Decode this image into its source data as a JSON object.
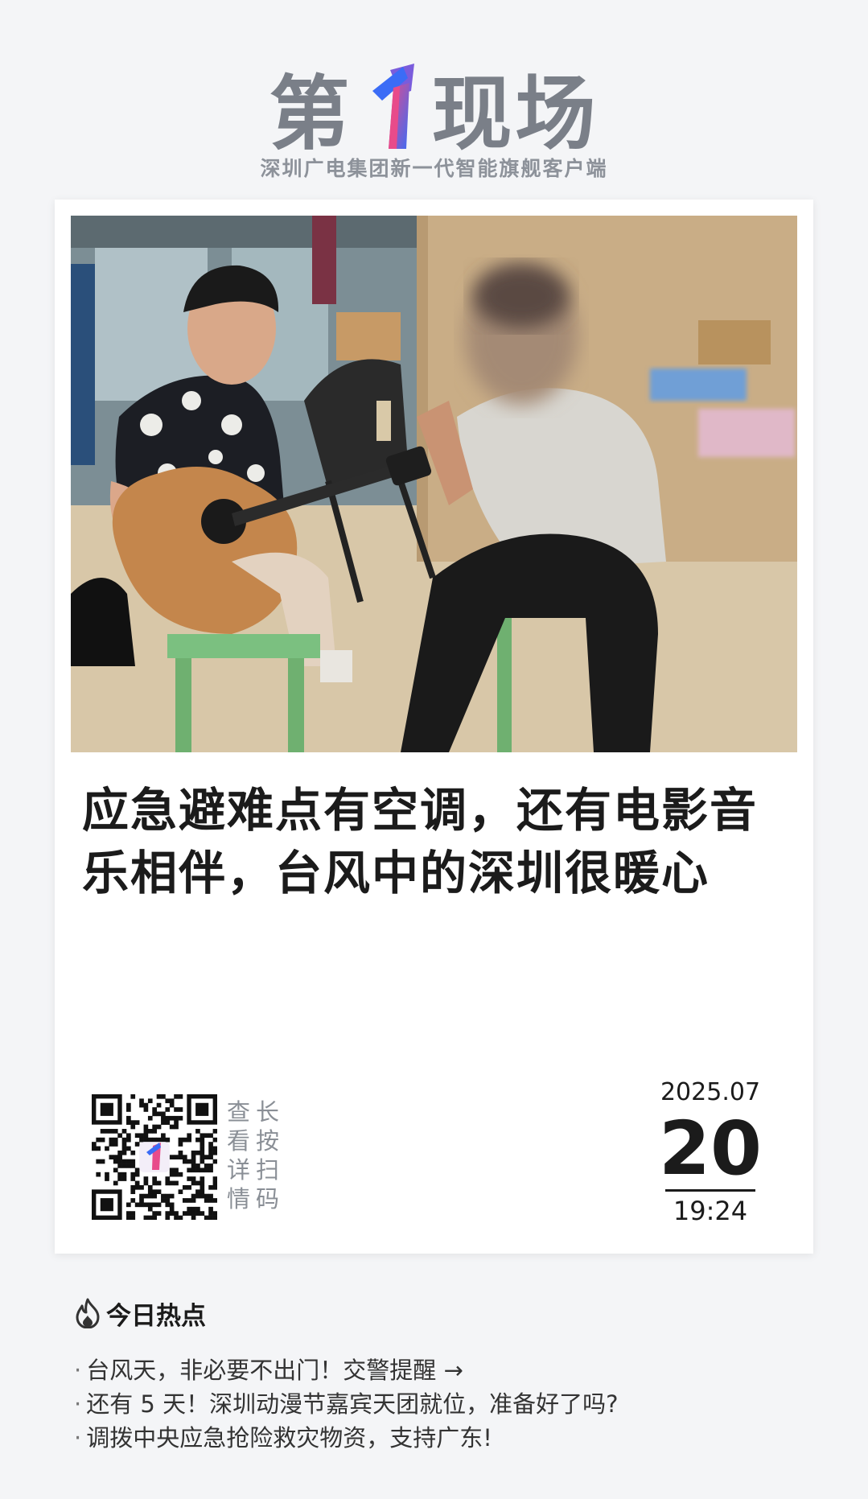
{
  "header": {
    "logo_left": "第",
    "logo_right": "现场",
    "tagline": "深圳广电集团新一代智能旗舰客户端",
    "brand_colors": [
      "#3b6cf6",
      "#e84b8a",
      "#7a7f88"
    ]
  },
  "article": {
    "headline": "应急避难点有空调，还有电影音乐相伴，台风中的深圳很暖心",
    "photo_icon": "news-photo"
  },
  "qr": {
    "icon": "qr-code-icon",
    "hint_chars": [
      "查",
      "长",
      "看",
      "按",
      "详",
      "扫",
      "情",
      "码"
    ]
  },
  "date": {
    "year_month": "2025.07",
    "day": "20",
    "time": "19:24"
  },
  "hot": {
    "icon": "fire-icon",
    "title": "今日热点",
    "items": [
      "台风天，非必要不出门！交警提醒 →",
      "还有 5 天！深圳动漫节嘉宾天团就位，准备好了吗?",
      "调拨中央应急抢险救灾物资，支持广东!"
    ]
  }
}
